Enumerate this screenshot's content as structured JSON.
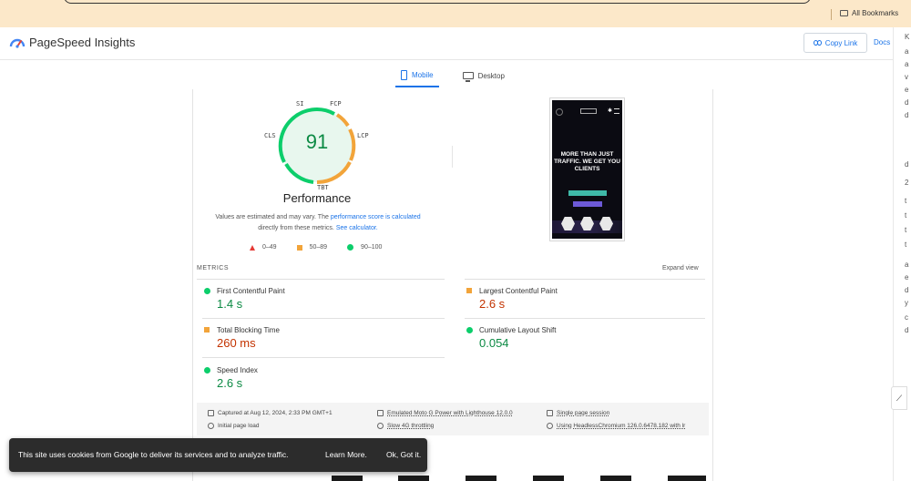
{
  "browser": {
    "bookmarks_label": "All Bookmarks"
  },
  "header": {
    "title": "PageSpeed Insights",
    "copy_link_label": "Copy Link",
    "docs_label": "Docs"
  },
  "tabs": [
    {
      "label": "Mobile",
      "active": true
    },
    {
      "label": "Desktop",
      "active": false
    }
  ],
  "summary": {
    "score": "91",
    "category": "Performance",
    "gauge_tags": {
      "si": "SI",
      "fcp": "FCP",
      "cls": "CLS",
      "lcp": "LCP",
      "tbt": "TBT"
    },
    "disclaimer_1": "Values are estimated and may vary. The",
    "disclaimer_link": "performance score is calculated",
    "disclaimer_2": "directly from these metrics.",
    "calculator_link": "See calculator.",
    "legend": [
      {
        "range": "0–49",
        "shape": "triangle",
        "color": "#e53935"
      },
      {
        "range": "50–89",
        "shape": "square",
        "color": "#f2a43a"
      },
      {
        "range": "90–100",
        "shape": "circle",
        "color": "#0cce6b"
      }
    ]
  },
  "preview": {
    "hero_text": "MORE THAN JUST TRAFFIC. WE GET YOU CLIENTS"
  },
  "metrics": {
    "section_label": "METRICS",
    "expand_label": "Expand view",
    "items": [
      {
        "name": "First Contentful Paint",
        "value": "1.4 s",
        "status": "good"
      },
      {
        "name": "Largest Contentful Paint",
        "value": "2.6 s",
        "status": "average"
      },
      {
        "name": "Total Blocking Time",
        "value": "260 ms",
        "status": "average"
      },
      {
        "name": "Cumulative Layout Shift",
        "value": "0.054",
        "status": "good"
      },
      {
        "name": "Speed Index",
        "value": "2.6 s",
        "status": "good"
      }
    ]
  },
  "info": {
    "captured": "Captured at Aug 12, 2024, 2:33 PM GMT+1",
    "initial_load": "Initial page load",
    "device": "Emulated Moto G Power with Lighthouse 12.0.0",
    "throttling": "Slow 4G throttling",
    "session": "Single page session",
    "browser": "Using HeadlessChromium 126.0.6478.182 with lr"
  },
  "cookie": {
    "text": "This site uses cookies from Google to deliver its services and to analyze traffic.",
    "learn_more": "Learn More.",
    "ok": "Ok, Got it."
  },
  "colors": {
    "good": "#0c8a44",
    "average": "#c33300",
    "accent": "#1a73e8"
  }
}
